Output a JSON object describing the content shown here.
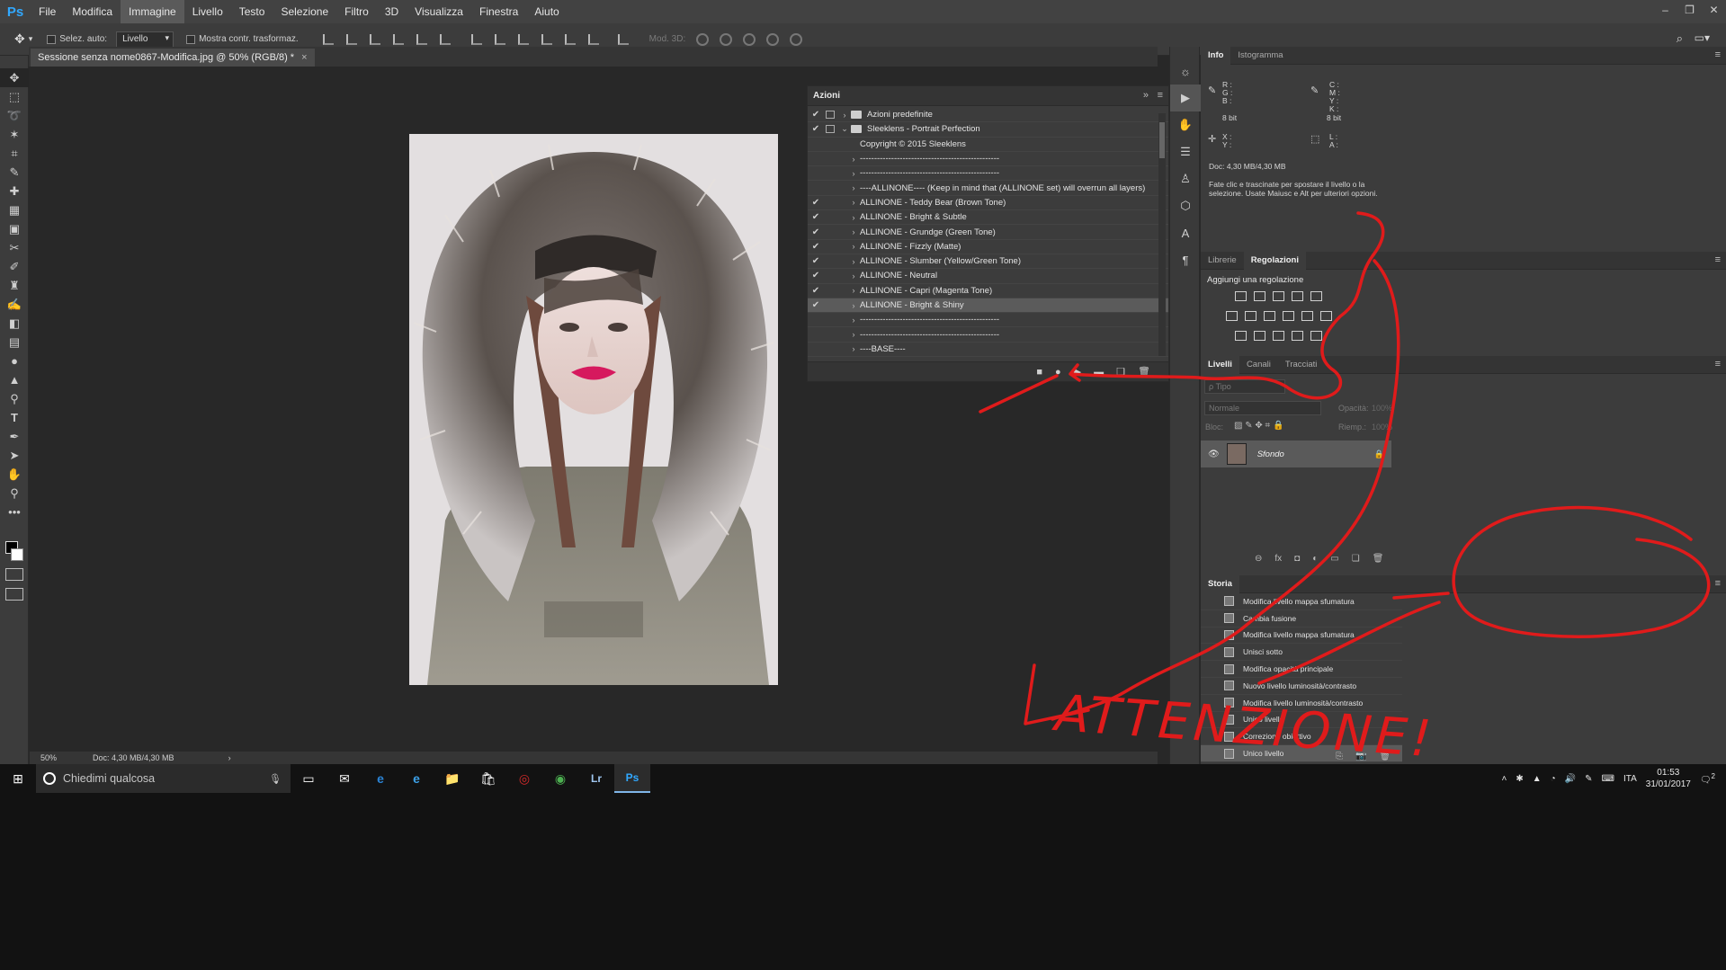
{
  "app": {
    "logo": "Ps"
  },
  "menu": [
    "File",
    "Modifica",
    "Immagine",
    "Livello",
    "Testo",
    "Selezione",
    "Filtro",
    "3D",
    "Visualizza",
    "Finestra",
    "Aiuto"
  ],
  "window_controls": [
    "–",
    "❐",
    "✕"
  ],
  "options_bar": {
    "auto_select_label": "Selez. auto:",
    "auto_select_value": "Livello",
    "show_transform_label": "Mostra contr. trasformaz.",
    "mode_3d_label": "Mod. 3D:"
  },
  "document": {
    "tab_title": "Sessione senza nome0867-Modifica.jpg @ 50% (RGB/8) *",
    "close": "×",
    "zoom": "50%",
    "doc_size": "Doc: 4,30 MB/4,30 MB",
    "status_arrow": "›"
  },
  "actions_panel": {
    "title": "Azioni",
    "collapse": "»",
    "rows": [
      {
        "label": "Azioni predefinite",
        "checked": true,
        "dialog": true,
        "folder": true,
        "open": false,
        "indent": 0
      },
      {
        "label": "Sleeklens - Portrait Perfection",
        "checked": true,
        "dialog": true,
        "folder": true,
        "open": true,
        "indent": 0
      },
      {
        "label": "Copyright © 2015 Sleeklens",
        "checked": false,
        "dialog": false,
        "folder": false,
        "open": false,
        "indent": 1,
        "noarrow": true
      },
      {
        "label": "-------------------------------------------------",
        "checked": false,
        "dialog": false,
        "folder": false,
        "open": false,
        "indent": 1
      },
      {
        "label": "-------------------------------------------------",
        "checked": false,
        "dialog": false,
        "folder": false,
        "open": false,
        "indent": 1
      },
      {
        "label": "----ALLINONE----  (Keep in mind that (ALLINONE set) will overrun all layers)",
        "checked": false,
        "dialog": false,
        "folder": false,
        "open": false,
        "indent": 1
      },
      {
        "label": "ALLINONE - Teddy Bear (Brown Tone)",
        "checked": true,
        "dialog": false,
        "folder": false,
        "open": false,
        "indent": 1
      },
      {
        "label": "ALLINONE - Bright & Subtle",
        "checked": true,
        "dialog": false,
        "folder": false,
        "open": false,
        "indent": 1
      },
      {
        "label": "ALLINONE - Grundge (Green Tone)",
        "checked": true,
        "dialog": false,
        "folder": false,
        "open": false,
        "indent": 1
      },
      {
        "label": "ALLINONE - Fizzly (Matte)",
        "checked": true,
        "dialog": false,
        "folder": false,
        "open": false,
        "indent": 1
      },
      {
        "label": "ALLINONE - Slumber (Yellow/Green Tone)",
        "checked": true,
        "dialog": false,
        "folder": false,
        "open": false,
        "indent": 1
      },
      {
        "label": "ALLINONE - Neutral",
        "checked": true,
        "dialog": false,
        "folder": false,
        "open": false,
        "indent": 1
      },
      {
        "label": "ALLINONE - Capri (Magenta Tone)",
        "checked": true,
        "dialog": false,
        "folder": false,
        "open": false,
        "indent": 1
      },
      {
        "label": "ALLINONE - Bright & Shiny",
        "checked": true,
        "dialog": false,
        "folder": false,
        "open": false,
        "indent": 1,
        "selected": true
      },
      {
        "label": "-------------------------------------------------",
        "checked": false,
        "dialog": false,
        "folder": false,
        "open": false,
        "indent": 1
      },
      {
        "label": "-------------------------------------------------",
        "checked": false,
        "dialog": false,
        "folder": false,
        "open": false,
        "indent": 1
      },
      {
        "label": "----BASE----",
        "checked": false,
        "dialog": false,
        "folder": false,
        "open": false,
        "indent": 1
      }
    ],
    "footer_buttons": [
      "■",
      "●",
      "▶",
      "▬",
      "❏",
      "🗑"
    ]
  },
  "info_panel": {
    "tabs": [
      "Info",
      "Istogramma"
    ],
    "rgb_labels": "R :\nG :\nB :",
    "rgb_bits": "8 bit",
    "cmyk_labels": "C :\nM :\nY :\nK :",
    "cmyk_bits": "8 bit",
    "xy_labels": "X :\nY :",
    "la_labels": "L :\nA :",
    "doc_size": "Doc: 4,30 MB/4,30 MB",
    "hint": "Fate clic e trascinate per spostare il livello o la selezione. Usate Maiusc e Alt per ulteriori opzioni."
  },
  "adjustments_panel": {
    "tabs": [
      "Librerie",
      "Regolazioni"
    ],
    "subtitle": "Aggiungi una regolazione"
  },
  "layers_panel": {
    "tabs": [
      "Livelli",
      "Canali",
      "Tracciati"
    ],
    "filter_placeholder": "ρ Tipo",
    "blend_mode": "Normale",
    "opacity_label": "Opacità:",
    "opacity_value": "100%",
    "lock_label": "Bloc:",
    "fill_label": "Riemp.:",
    "fill_value": "100%",
    "layer_name": "Sfondo",
    "footer": [
      "⊖",
      "fx",
      "◘",
      "◐",
      "▭",
      "❏",
      "🗑"
    ]
  },
  "history_panel": {
    "title": "Storia",
    "items": [
      "Modifica livello mappa sfumatura",
      "Cambia fusione",
      "Modifica livello mappa sfumatura",
      "Unisci sotto",
      "Modifica opacità principale",
      "Nuovo livello luminosità/contrasto",
      "Modifica livello luminosità/contrasto",
      "Unico livello",
      "Correzione obiettivo",
      "Unico livello"
    ],
    "selected_index": 9
  },
  "annotation": {
    "text": "ATTENZIONE!",
    "color": "#e01b1b"
  },
  "taskbar": {
    "search_placeholder": "Chiedimi qualcosa",
    "apps": [
      "▭",
      "✉",
      "e",
      "e",
      "📁",
      "🛍",
      "◎",
      "◉",
      "Lr",
      "Ps"
    ],
    "language": "ITA",
    "time": "01:53",
    "date": "31/01/2017",
    "notification_count": "2"
  }
}
